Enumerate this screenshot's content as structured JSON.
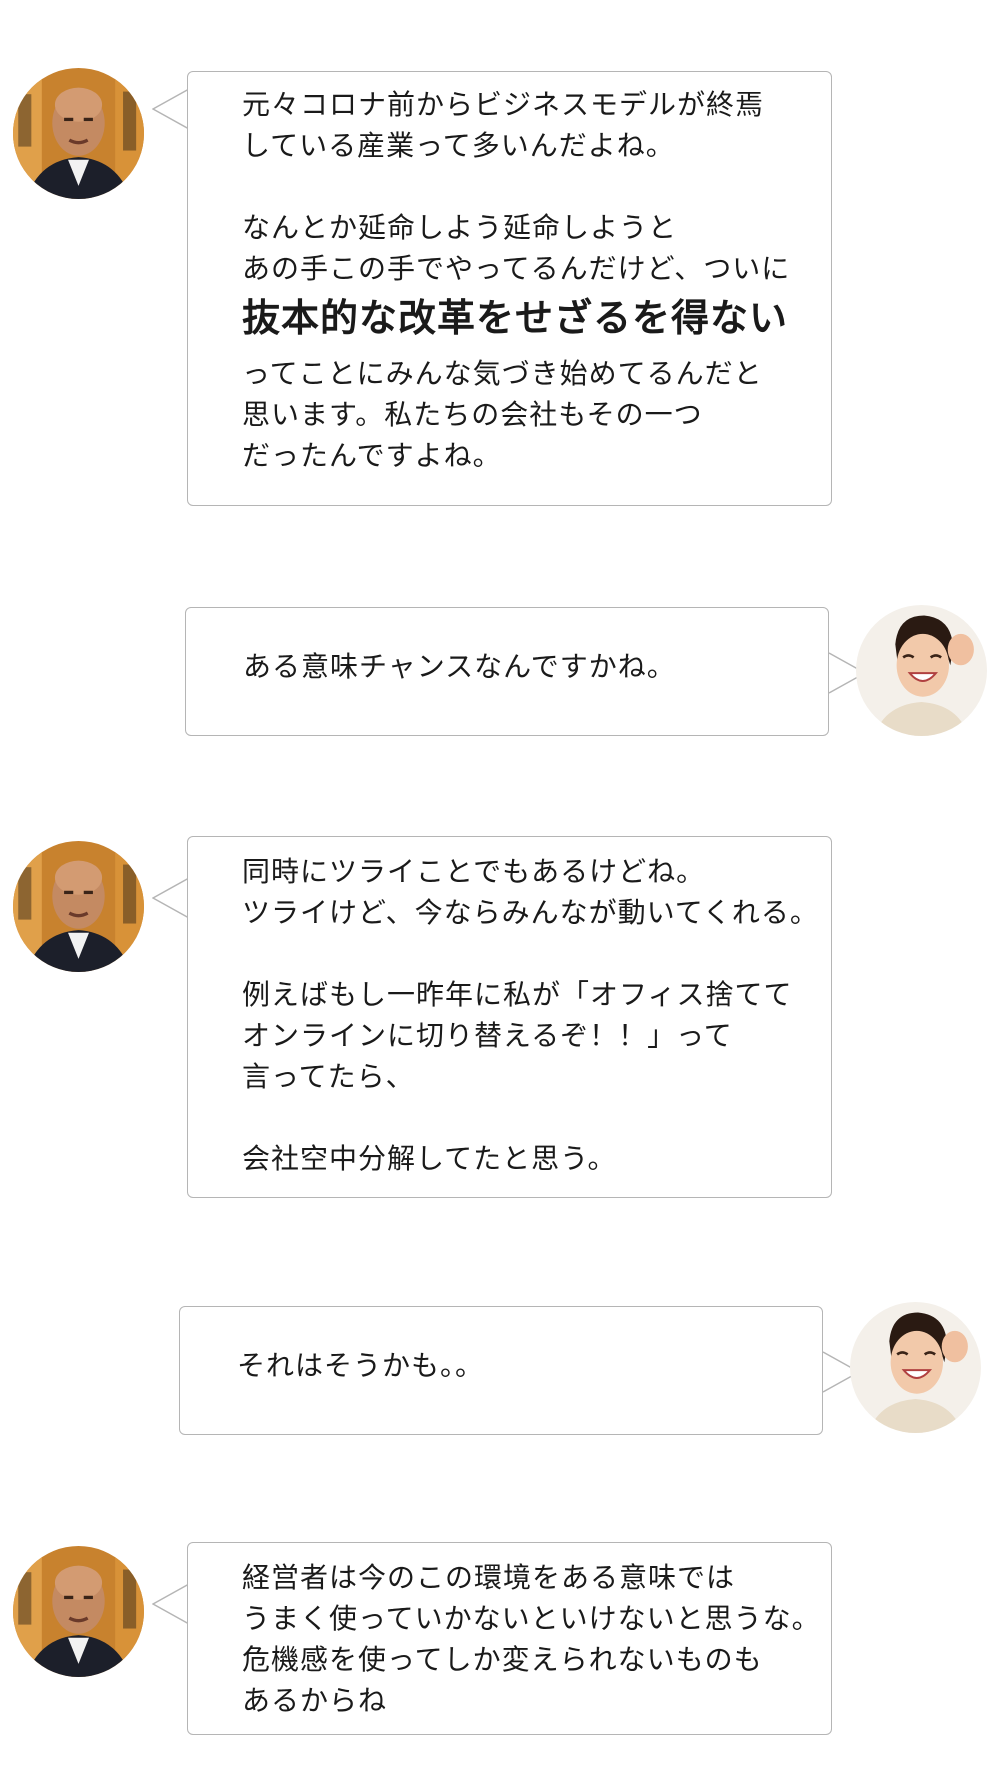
{
  "messages": [
    {
      "speaker": "man",
      "lines": [
        "元々コロナ前からビジネスモデルが終焉",
        "している産業って多いんだよね。",
        "",
        "なんとか延命しよう延命しようと",
        "あの手この手でやってるんだけど、ついに"
      ],
      "emphasis": "抜本的な改革をせざるを得ない",
      "after": [
        "ってことにみんな気づき始めてるんだと",
        "思います。私たちの会社もその一つ",
        "だったんですよね。"
      ]
    },
    {
      "speaker": "woman",
      "lines": [
        "ある意味チャンスなんですかね。"
      ]
    },
    {
      "speaker": "man",
      "lines": [
        "同時にツライことでもあるけどね。",
        "ツライけど、今ならみんなが動いてくれる。",
        "",
        "例えばもし一昨年に私が「オフィス捨てて",
        "オンラインに切り替えるぞ！！」って",
        "言ってたら、",
        "",
        "会社空中分解してたと思う。"
      ]
    },
    {
      "speaker": "woman",
      "lines": [
        "それはそうかも。。"
      ]
    },
    {
      "speaker": "man",
      "lines": [
        "経営者は今のこの環境をある意味では",
        "うまく使っていかないといけないと思うな。",
        "危機感を使ってしか変えられないものも",
        "あるからね"
      ]
    }
  ]
}
